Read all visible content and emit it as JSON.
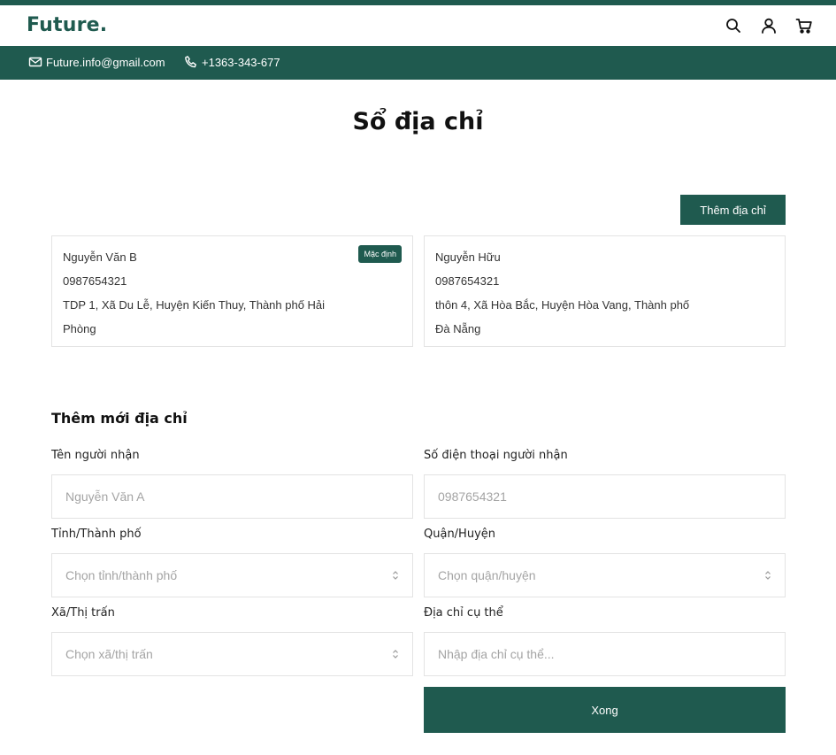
{
  "brand": {
    "logo": "Future.",
    "color": "#1f5a4f"
  },
  "header": {
    "icons": [
      "search-icon",
      "user-icon",
      "cart-icon"
    ]
  },
  "contact": {
    "email": "Future.info@gmail.com",
    "phone": "+1363-343-677"
  },
  "page": {
    "title": "Sổ địa chỉ"
  },
  "actions": {
    "add_address": "Thêm địa chỉ"
  },
  "addresses": [
    {
      "name": "Nguyễn Văn B",
      "phone": "0987654321",
      "detail": "TDP 1, Xã Du Lễ, Huyện Kiến Thuy, Thành phố Hải Phòng",
      "badge": "Mặc định"
    },
    {
      "name": "Nguyễn Hữu",
      "phone": "0987654321",
      "detail": "thôn 4, Xã Hòa Bắc, Huyện Hòa Vang, Thành phố Đà Nẵng"
    }
  ],
  "form": {
    "title": "Thêm mới địa chỉ",
    "recipient": {
      "label": "Tên người nhận",
      "placeholder": "Nguyễn Văn A"
    },
    "phone": {
      "label": "Số điện thoại người nhận",
      "placeholder": "0987654321"
    },
    "province": {
      "label": "Tỉnh/Thành phố",
      "placeholder": "Chọn tỉnh/thành phố"
    },
    "district": {
      "label": "Quận/Huyện",
      "placeholder": "Chọn quận/huyện"
    },
    "ward": {
      "label": "Xã/Thị trấn",
      "placeholder": "Chọn xã/thị trấn"
    },
    "street": {
      "label": "Địa chỉ cụ thể",
      "placeholder": "Nhập địa chỉ cụ thể..."
    },
    "submit": "Xong"
  }
}
